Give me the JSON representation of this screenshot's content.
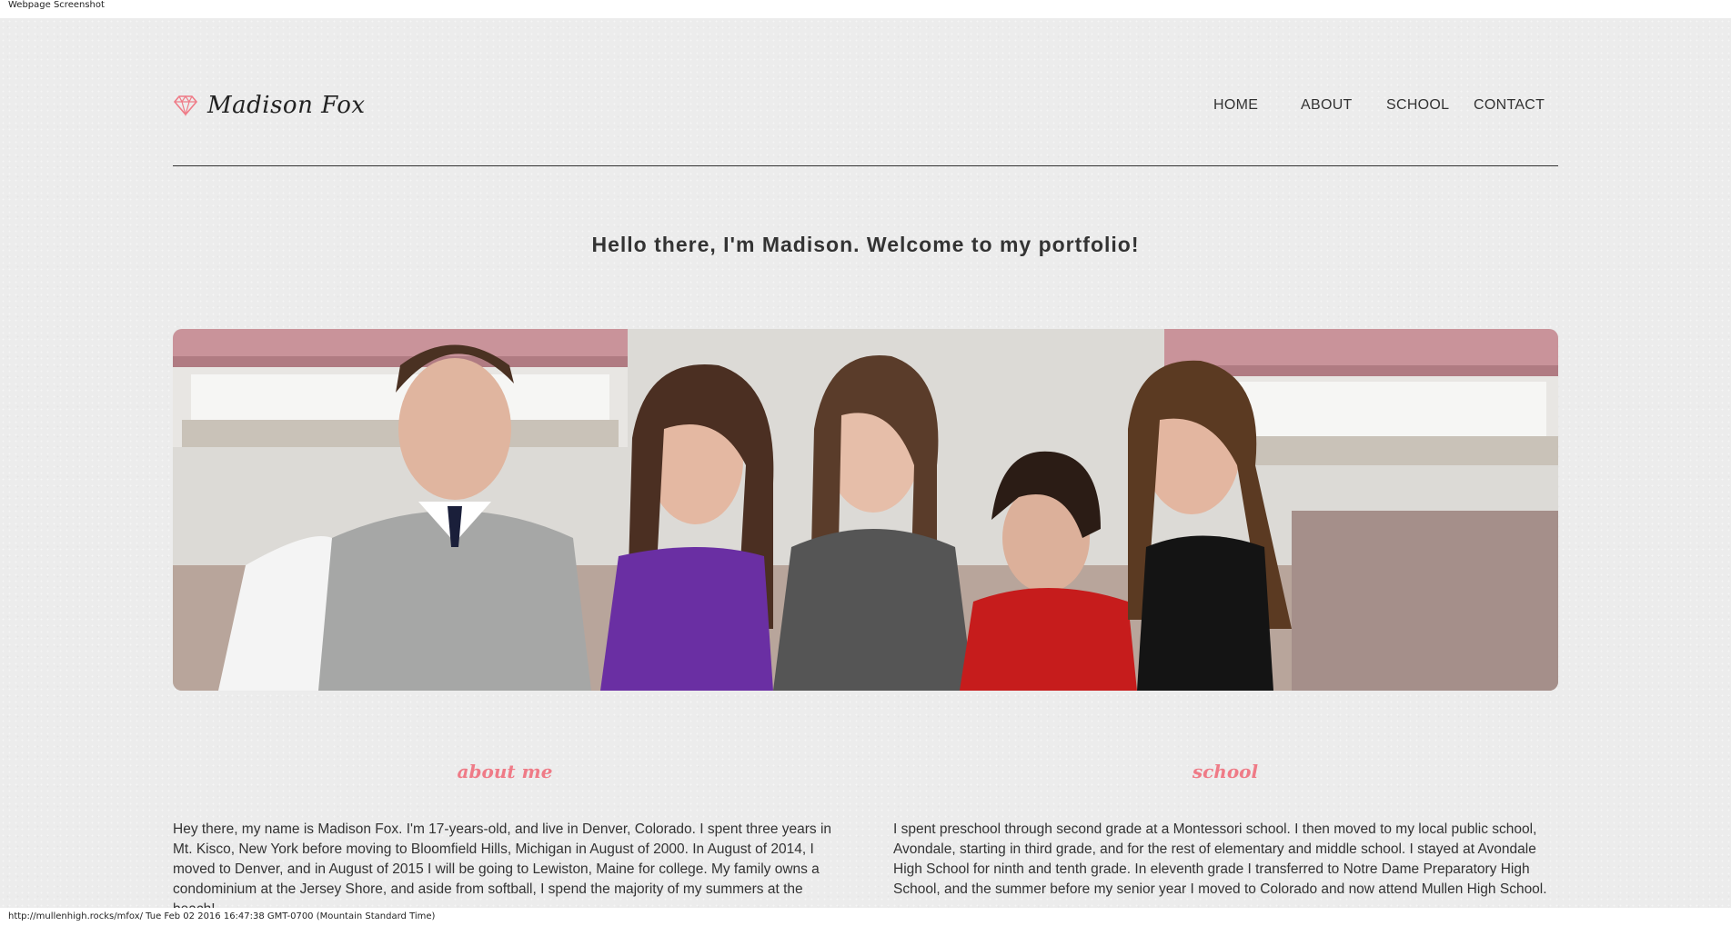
{
  "screenshot_caption": "Webpage Screenshot",
  "brand": {
    "name": "Madison Fox",
    "icon": "diamond-icon",
    "icon_color": "#ef7b87"
  },
  "nav": {
    "items": [
      "HOME",
      "ABOUT",
      "SCHOOL",
      "CONTACT"
    ]
  },
  "hero": {
    "welcome": "Hello there, I'm Madison. Welcome to my portfolio!",
    "photo": "family-photo"
  },
  "sections": {
    "about": {
      "title": "about me",
      "text": "Hey there, my name is Madison Fox. I'm 17-years-old, and live in Denver, Colorado. I spent three years in Mt. Kisco, New York before moving to Bloomfield Hills, Michigan in August of 2000. In August of 2014, I moved to Denver, and in August of 2015 I will be going to Lewiston, Maine for college. My family owns a condominium at the Jersey Shore, and aside from softball, I spend the majority of my summers at the beach!"
    },
    "school": {
      "title": "school",
      "text": "I spent preschool through second grade at a Montessori school. I then moved to my local public school, Avondale, starting in third grade, and for the rest of elementary and middle school. I stayed at Avondale High School for ninth and tenth grade. In eleventh grade I transferred to Notre Dame Preparatory High School, and the summer before my senior year I moved to Colorado and now attend Mullen High School."
    }
  },
  "status_bar": "http://mullenhigh.rocks/mfox/ Tue Feb 02 2016 16:47:38 GMT-0700 (Mountain Standard Time)",
  "colors": {
    "accent": "#ef7b87",
    "background": "#ececec",
    "text": "#333333"
  }
}
